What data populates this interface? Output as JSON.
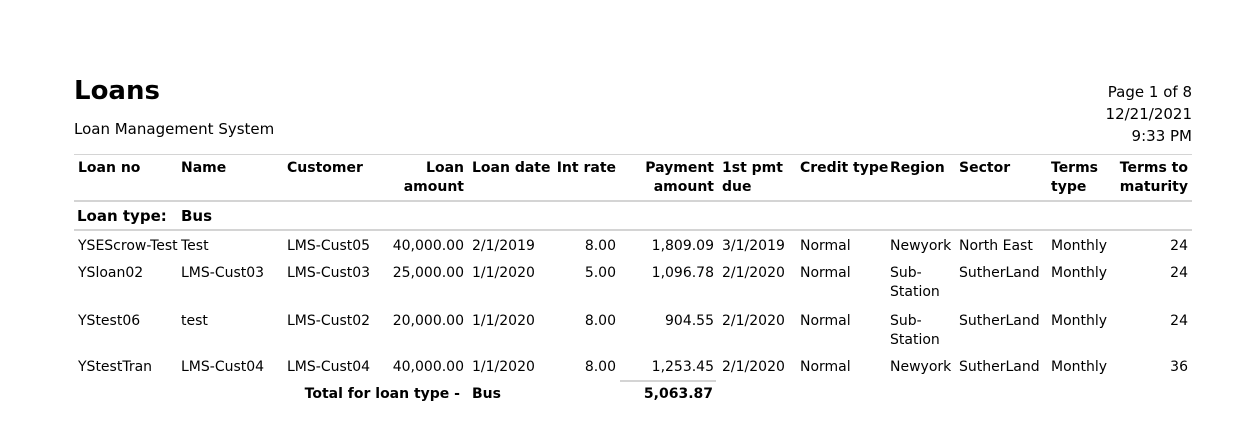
{
  "report": {
    "title": "Loans",
    "subtitle": "Loan Management System",
    "page_label": "Page",
    "page_current": "1",
    "page_of": "of",
    "page_total": "8",
    "date": "12/21/2021",
    "time": "9:33 PM"
  },
  "columns": {
    "loan_no": "Loan no",
    "name": "Name",
    "customer": "Customer",
    "loan_amount_1": "Loan",
    "loan_amount_2": "amount",
    "loan_date": "Loan date",
    "int_rate": "Int rate",
    "payment_amount_1": "Payment",
    "payment_amount_2": "amount",
    "first_pmt_1": "1st pmt",
    "first_pmt_2": "due",
    "credit_type": "Credit type",
    "region": "Region",
    "sector": "Sector",
    "terms_type_1": "Terms",
    "terms_type_2": "type",
    "terms_maturity_1": "Terms to",
    "terms_maturity_2": "maturity"
  },
  "group": {
    "label": "Loan type:",
    "value": "Bus"
  },
  "rows": [
    {
      "loan_no": "YSEScrow-Test",
      "name": "Test",
      "customer": "LMS-Cust05",
      "loan_amount": "40,000.00",
      "loan_date": "2/1/2019",
      "int_rate": "8.00",
      "payment_amount": "1,809.09",
      "first_pmt": "3/1/2019",
      "credit_type": "Normal",
      "region_1": "Newyork",
      "region_2": "",
      "sector": "North East",
      "terms_type": "Monthly",
      "terms_maturity": "24"
    },
    {
      "loan_no": "YSloan02",
      "name": "LMS-Cust03",
      "customer": "LMS-Cust03",
      "loan_amount": "25,000.00",
      "loan_date": "1/1/2020",
      "int_rate": "5.00",
      "payment_amount": "1,096.78",
      "first_pmt": "2/1/2020",
      "credit_type": "Normal",
      "region_1": "Sub-",
      "region_2": "Station",
      "sector": "SutherLand",
      "terms_type": "Monthly",
      "terms_maturity": "24"
    },
    {
      "loan_no": "YStest06",
      "name": "test",
      "customer": "LMS-Cust02",
      "loan_amount": "20,000.00",
      "loan_date": "1/1/2020",
      "int_rate": "8.00",
      "payment_amount": "904.55",
      "first_pmt": "2/1/2020",
      "credit_type": "Normal",
      "region_1": "Sub-",
      "region_2": "Station",
      "sector": "SutherLand",
      "terms_type": "Monthly",
      "terms_maturity": "24"
    },
    {
      "loan_no": "YStestTran",
      "name": "LMS-Cust04",
      "customer": "LMS-Cust04",
      "loan_amount": "40,000.00",
      "loan_date": "1/1/2020",
      "int_rate": "8.00",
      "payment_amount": "1,253.45",
      "first_pmt": "2/1/2020",
      "credit_type": "Normal",
      "region_1": "Newyork",
      "region_2": "",
      "sector": "SutherLand",
      "terms_type": "Monthly",
      "terms_maturity": "36"
    }
  ],
  "total": {
    "label": "Total for loan type -",
    "type": "Bus",
    "payment_amount": "5,063.87"
  }
}
